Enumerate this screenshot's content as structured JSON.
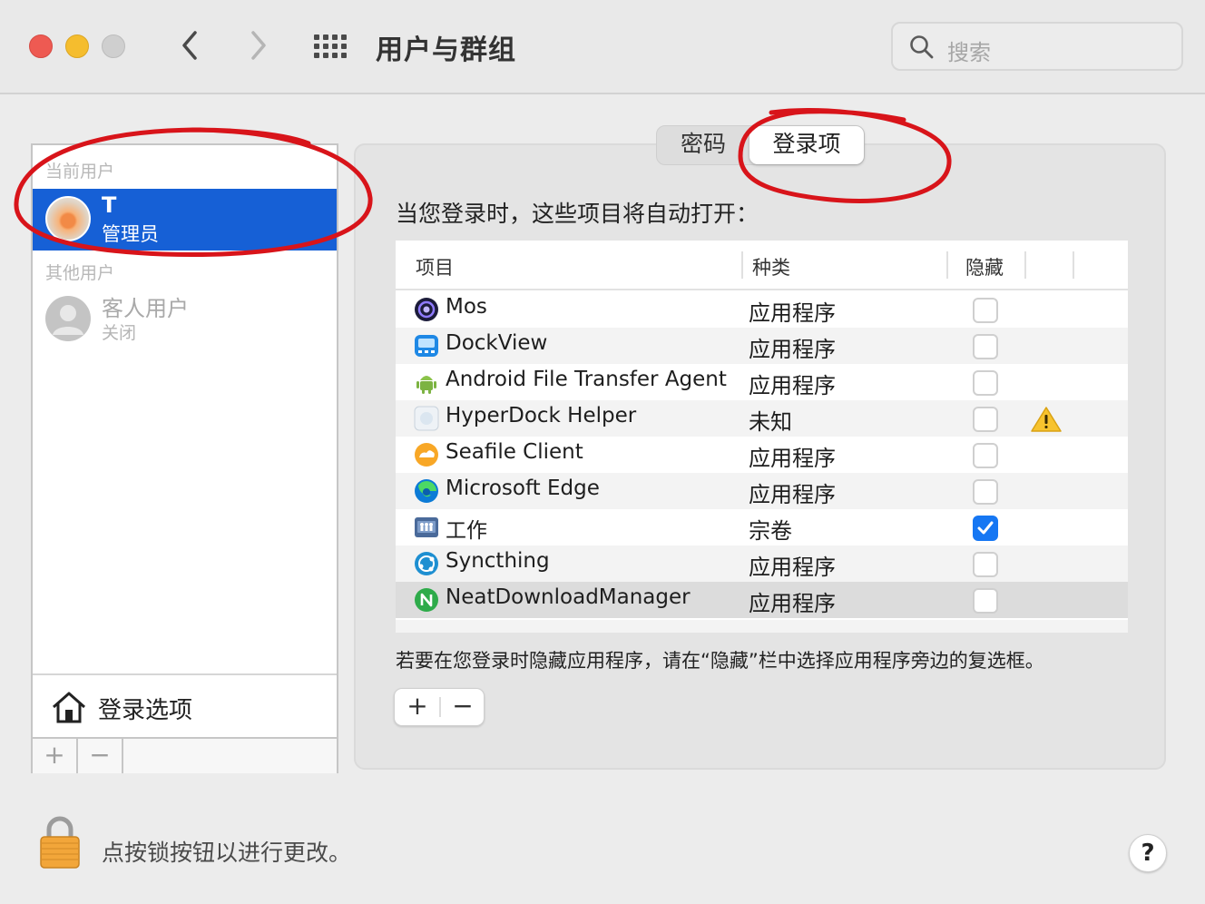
{
  "window": {
    "title": "用户与群组",
    "search_placeholder": "搜索"
  },
  "sidebar": {
    "current_users_header": "当前用户",
    "current_user": {
      "name": "T",
      "role": "管理员"
    },
    "other_users_header": "其他用户",
    "guest_user": {
      "name": "客人用户",
      "status": "关闭"
    },
    "login_options_label": "登录选项",
    "add_label": "+",
    "remove_label": "−"
  },
  "tabs": [
    {
      "label": "密码",
      "selected": false
    },
    {
      "label": "登录项",
      "selected": true
    }
  ],
  "login_items": {
    "description": "当您登录时，这些项目将自动打开：",
    "columns": {
      "item": "项目",
      "kind": "种类",
      "hide": "隐藏"
    },
    "rows": [
      {
        "name": "Mos",
        "kind": "应用程序",
        "hidden": false,
        "icon": "mos-icon"
      },
      {
        "name": "DockView",
        "kind": "应用程序",
        "hidden": false,
        "icon": "dockview-icon"
      },
      {
        "name": "Android File Transfer Agent",
        "kind": "应用程序",
        "hidden": false,
        "icon": "android-icon"
      },
      {
        "name": "HyperDock Helper",
        "kind": "未知",
        "hidden": false,
        "icon": "hyperdock-icon",
        "warning": true
      },
      {
        "name": "Seafile Client",
        "kind": "应用程序",
        "hidden": false,
        "icon": "seafile-icon"
      },
      {
        "name": "Microsoft Edge",
        "kind": "应用程序",
        "hidden": false,
        "icon": "edge-icon"
      },
      {
        "name": "工作",
        "kind": "宗卷",
        "hidden": true,
        "icon": "volume-icon"
      },
      {
        "name": "Syncthing",
        "kind": "应用程序",
        "hidden": false,
        "icon": "syncthing-icon"
      },
      {
        "name": "NeatDownloadManager",
        "kind": "应用程序",
        "hidden": false,
        "icon": "ndm-icon",
        "selected": true
      }
    ],
    "hint": "若要在您登录时隐藏应用程序，请在“隐藏”栏中选择应用程序旁边的复选框。",
    "add_label": "+",
    "remove_label": "−"
  },
  "footer": {
    "lock_text": "点按锁按钮以进行更改。",
    "help_label": "?"
  },
  "colors": {
    "selection": "#1660d6",
    "checkbox_on": "#1677f3",
    "annotation": "#d8141a"
  }
}
